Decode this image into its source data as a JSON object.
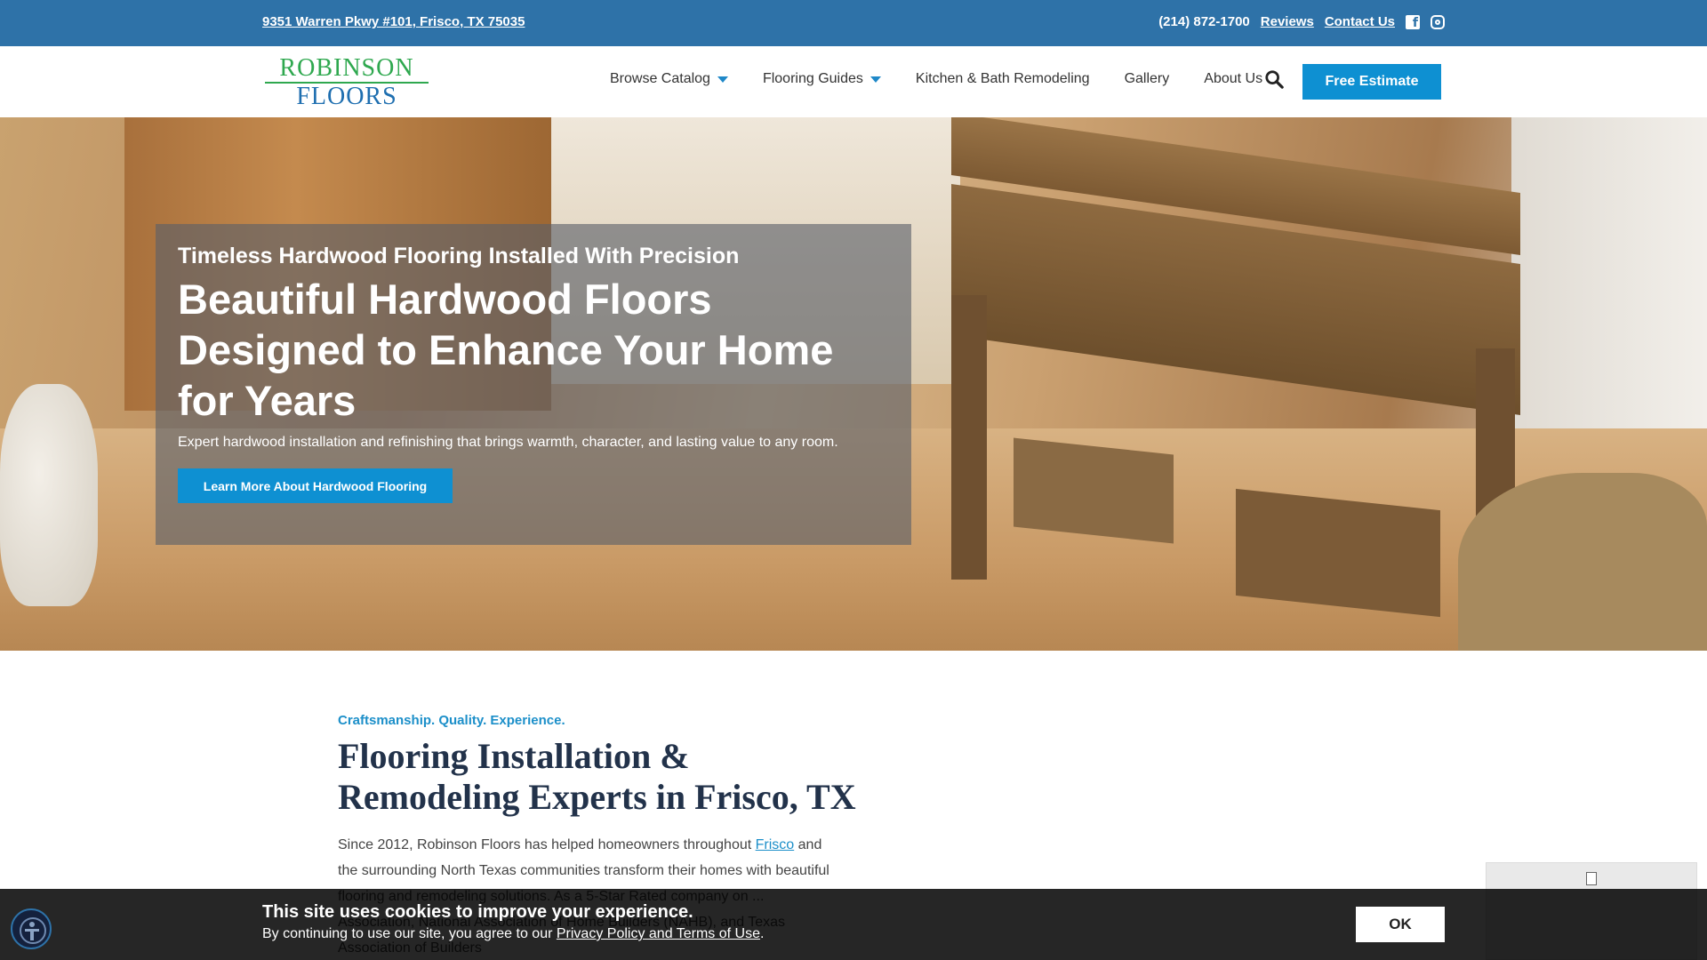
{
  "topbar": {
    "address": "9351 Warren Pkwy #101, Frisco, TX 75035",
    "phone": "(214) 872-1700",
    "reviews": "Reviews",
    "contact": "Contact Us",
    "facebook_icon": "facebook-icon",
    "instagram_icon": "instagram-icon",
    "bg_color": "#2e72a8"
  },
  "logo": {
    "line1": "ROBINSON",
    "line2": "FLOORS"
  },
  "nav": {
    "items": [
      {
        "label": "Browse Catalog",
        "dropdown": true
      },
      {
        "label": "Flooring Guides",
        "dropdown": true
      },
      {
        "label": "Kitchen & Bath Remodeling",
        "dropdown": false
      },
      {
        "label": "Gallery",
        "dropdown": false
      },
      {
        "label": "About Us",
        "dropdown": false
      }
    ],
    "search_icon": "search-icon",
    "estimate_label": "Free Estimate",
    "accent_color": "#0e90d2"
  },
  "hero": {
    "eyebrow": "Timeless Hardwood Flooring Installed With Precision",
    "title": "Beautiful Hardwood Floors Designed to Enhance Your Home for Years",
    "subtitle": "Expert hardwood installation and refinishing that brings warmth, character, and lasting value to any room.",
    "cta_label": "Learn More About Hardwood Flooring"
  },
  "content": {
    "eyebrow": "Craftsmanship. Quality. Experience.",
    "heading": "Flooring Installation & Remodeling Experts in Frisco, TX",
    "para_before": "Since 2012, Robinson Floors has helped homeowners throughout ",
    "para_link": "Frisco",
    "para_after": " and the surrounding North Texas communities transform their homes with beautiful flooring and remodeling solutions. As a 5-Star Rated company on ... Association, National Association of Home Builders (NAHB), and Texas Association of Builders"
  },
  "cookie": {
    "title": "This site uses cookies to improve your experience.",
    "msg_before": "By continuing to use our site, you agree to our ",
    "msg_link": "Privacy Policy and Terms of Use",
    "msg_after": ".",
    "ok_label": "OK"
  },
  "accessibility": {
    "icon": "accessibility-icon"
  }
}
